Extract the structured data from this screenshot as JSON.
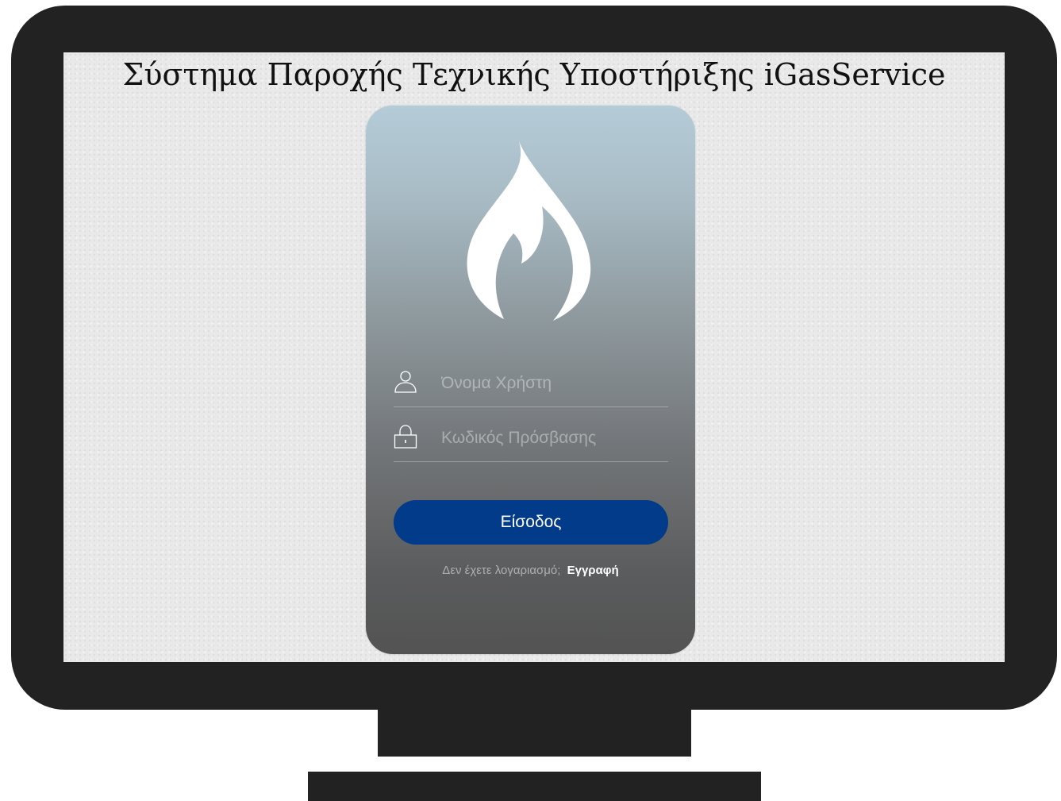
{
  "page": {
    "title": "Σύστημα Παροχής Τεχνικής Υποστήριξης iGasService"
  },
  "login": {
    "username_placeholder": "Όνομα Χρήστη",
    "username_value": "",
    "password_placeholder": "Κωδικός Πρόσβασης",
    "password_value": "",
    "submit_label": "Είσοδος",
    "register_prompt": "Δεν έχετε λογαριασμό;",
    "register_link": "Εγγραφή"
  },
  "icons": {
    "logo": "flame-icon",
    "username": "user-icon",
    "password": "lock-icon"
  },
  "colors": {
    "monitor": "#222222",
    "screen_background": "#e9e9e9",
    "card_top": "#b4ccd8",
    "card_bottom": "#535353",
    "button": "#023b8a",
    "button_text": "#ffffff"
  }
}
